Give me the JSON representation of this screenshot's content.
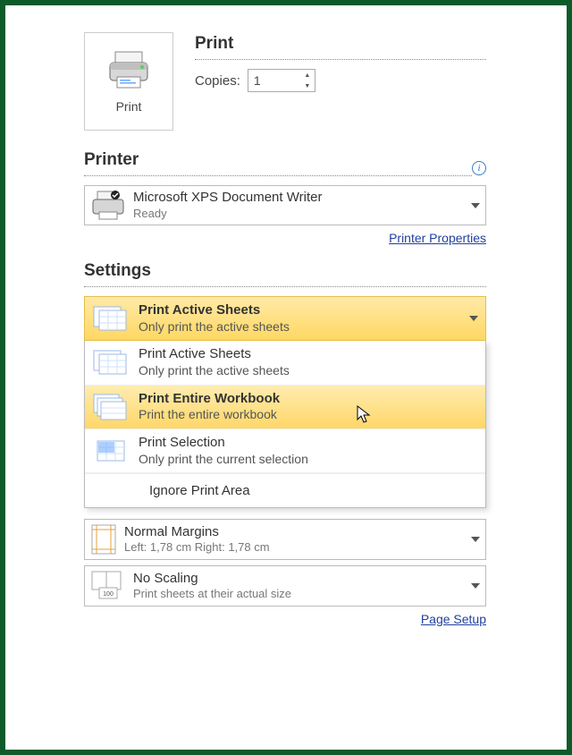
{
  "print": {
    "button_label": "Print",
    "title": "Print",
    "copies_label": "Copies:",
    "copies_value": "1"
  },
  "printer": {
    "title": "Printer",
    "name": "Microsoft XPS Document Writer",
    "status": "Ready",
    "properties_link": "Printer Properties"
  },
  "settings": {
    "title": "Settings",
    "selected": {
      "title": "Print Active Sheets",
      "desc": "Only print the active sheets"
    },
    "options": [
      {
        "title": "Print Active Sheets",
        "desc": "Only print the active sheets"
      },
      {
        "title": "Print Entire Workbook",
        "desc": "Print the entire workbook"
      },
      {
        "title": "Print Selection",
        "desc": "Only print the current selection"
      }
    ],
    "ignore_label": "Ignore Print Area",
    "margins": {
      "title": "Normal Margins",
      "desc": "Left: 1,78 cm   Right: 1,78 cm"
    },
    "scaling": {
      "title": "No Scaling",
      "desc": "Print sheets at their actual size"
    },
    "page_setup_link": "Page Setup"
  }
}
